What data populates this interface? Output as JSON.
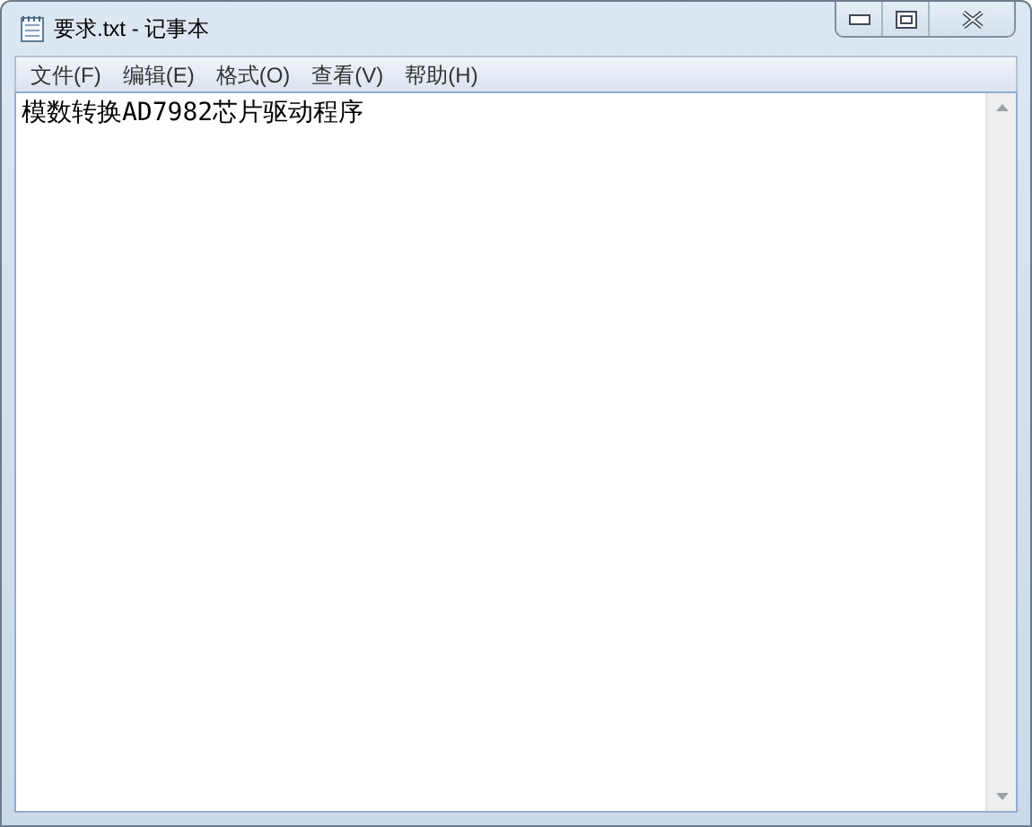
{
  "window": {
    "title": "要求.txt - 记事本"
  },
  "menu": [
    "文件(F)",
    "编辑(E)",
    "格式(O)",
    "查看(V)",
    "帮助(H)"
  ],
  "document": {
    "text": "模数转换AD7982芯片驱动程序"
  }
}
